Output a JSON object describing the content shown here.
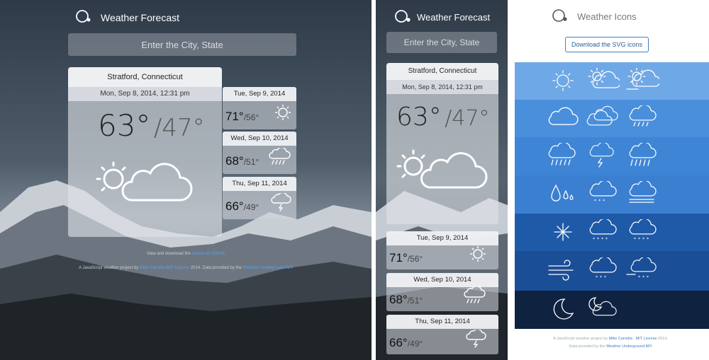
{
  "app": {
    "title": "Weather Forecast",
    "search_placeholder": "Enter the City, State"
  },
  "current": {
    "city": "Stratford, Connecticut",
    "datetime": "Mon, Sep 8, 2014, 12:31 pm",
    "high": "63°",
    "low": "/47°",
    "icon": "partly-cloudy-icon"
  },
  "forecast": [
    {
      "date": "Tue, Sep 9, 2014",
      "high": "71°",
      "low": "/56°",
      "icon": "sun-icon"
    },
    {
      "date": "Wed, Sep 10, 2014",
      "high": "68°",
      "low": "/51°",
      "icon": "rain-cloud-icon"
    },
    {
      "date": "Thu, Sep 11, 2014",
      "high": "66°",
      "low": "/49°",
      "icon": "thunder-cloud-icon"
    }
  ],
  "credits": {
    "view_prefix": "View and download the",
    "view_link": "source on GitHub",
    "line2_prefix": "A JavaScript weather project by",
    "author": "Mike Carretta",
    "license": "MIT License",
    "line2_year": "2014. Data provided by the",
    "api": "Weather Underground API"
  },
  "icons_page": {
    "title": "Weather Icons",
    "download_label": "Download the SVG icons",
    "footer_line1_prefix": "A JavaScript weather project by",
    "footer_author": "Mike Carretta",
    "footer_sep": " - ",
    "footer_license": "MIT License",
    "footer_year": "2014.",
    "footer_line2_prefix": "Data provided by the",
    "footer_api": "Weather Underground API",
    "bands": [
      {
        "color": "#6fa8e6",
        "icons": [
          "sun-icon",
          "partly-cloudy-icon",
          "sun-fog-icon"
        ]
      },
      {
        "color": "#4a8fdc",
        "icons": [
          "cloud-icon",
          "clouds-icon",
          "drizzle-cloud-icon"
        ]
      },
      {
        "color": "#3f85d6",
        "icons": [
          "rain-cloud-icon",
          "thunder-cloud-icon",
          "heavy-rain-cloud-icon"
        ]
      },
      {
        "color": "#3b7fd1",
        "icons": [
          "raindrops-icon",
          "sleet-cloud-icon",
          "fog-cloud-icon"
        ]
      },
      {
        "color": "#1e5aa8",
        "icons": [
          "snowflake-icon",
          "snow-rain-cloud-icon",
          "snow-cloud-icon"
        ]
      },
      {
        "color": "#1a4e96",
        "icons": [
          "wind-icon",
          "flurries-cloud-icon",
          "windy-snow-cloud-icon"
        ]
      },
      {
        "color": "#0f2240",
        "icons": [
          "moon-icon",
          "moon-cloud-icon"
        ]
      }
    ]
  }
}
